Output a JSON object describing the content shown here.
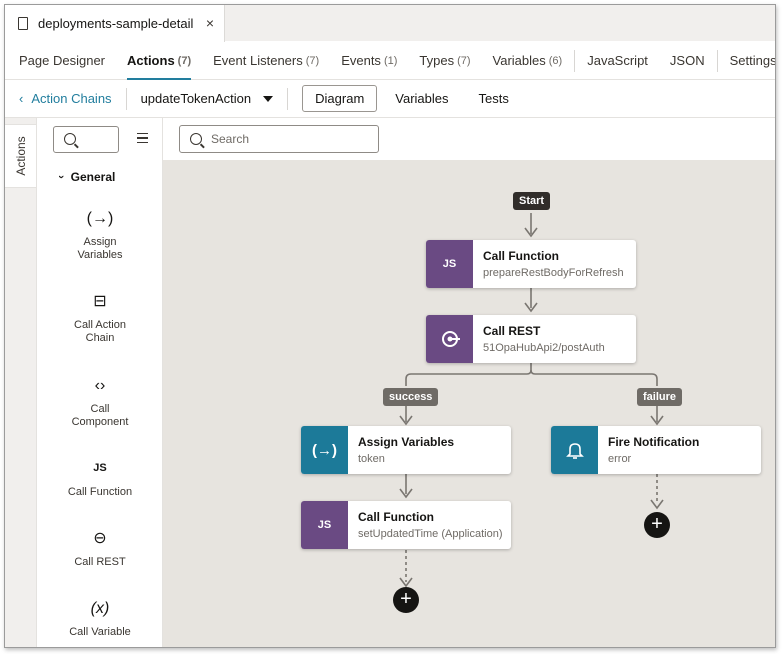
{
  "file_tab": {
    "title": "deployments-sample-detail",
    "close": "×"
  },
  "designer_tabs": [
    {
      "label": "Page Designer",
      "count": ""
    },
    {
      "label": "Actions",
      "count": "(7)"
    },
    {
      "label": "Event Listeners",
      "count": "(7)"
    },
    {
      "label": "Events",
      "count": "(1)"
    },
    {
      "label": "Types",
      "count": "(7)"
    },
    {
      "label": "Variables",
      "count": "(6)"
    },
    {
      "label": "JavaScript",
      "count": ""
    },
    {
      "label": "JSON",
      "count": ""
    },
    {
      "label": "Settings",
      "count": ""
    }
  ],
  "active_designer_tab": "Actions",
  "chain_toolbar": {
    "back_label": "Action Chains",
    "chain_name": "updateTokenAction",
    "view_tabs": [
      "Diagram",
      "Variables",
      "Tests"
    ],
    "active_view": "Diagram"
  },
  "vertical_tab": "Actions",
  "palette": {
    "group": "General",
    "items": [
      {
        "label": "Assign Variables",
        "icon": "assign-variables-icon",
        "glyph": "(→)"
      },
      {
        "label": "Call Action Chain",
        "icon": "action-chain-icon",
        "glyph": "⊟"
      },
      {
        "label": "Call Component",
        "icon": "component-icon",
        "glyph": "‹›"
      },
      {
        "label": "Call Function",
        "icon": "js-icon",
        "glyph": "JS"
      },
      {
        "label": "Call REST",
        "icon": "rest-icon",
        "glyph": "⊖"
      },
      {
        "label": "Call Variable",
        "icon": "variable-icon",
        "glyph": "(x)"
      }
    ]
  },
  "canvas_search": {
    "placeholder": "Search"
  },
  "diagram": {
    "start_label": "Start",
    "success_label": "success",
    "failure_label": "failure",
    "nodes": [
      {
        "title": "Call Function",
        "subtitle": "prepareRestBodyForRefresh",
        "badge": "JS"
      },
      {
        "title": "Call REST",
        "subtitle": "51OpaHubApi2/postAuth",
        "badge": "REST"
      },
      {
        "title": "Assign Variables",
        "subtitle": "token",
        "badge": "(→)"
      },
      {
        "title": "Fire Notification",
        "subtitle": "error",
        "badge": "bell"
      },
      {
        "title": "Call Function",
        "subtitle": "setUpdatedTime (Application)",
        "badge": "JS"
      }
    ],
    "add_symbol": "+"
  },
  "colors": {
    "accent": "#227e9e",
    "purple_badge": "#6a4a83",
    "teal_badge": "#1c7a99",
    "canvas": "#e7e4df"
  }
}
